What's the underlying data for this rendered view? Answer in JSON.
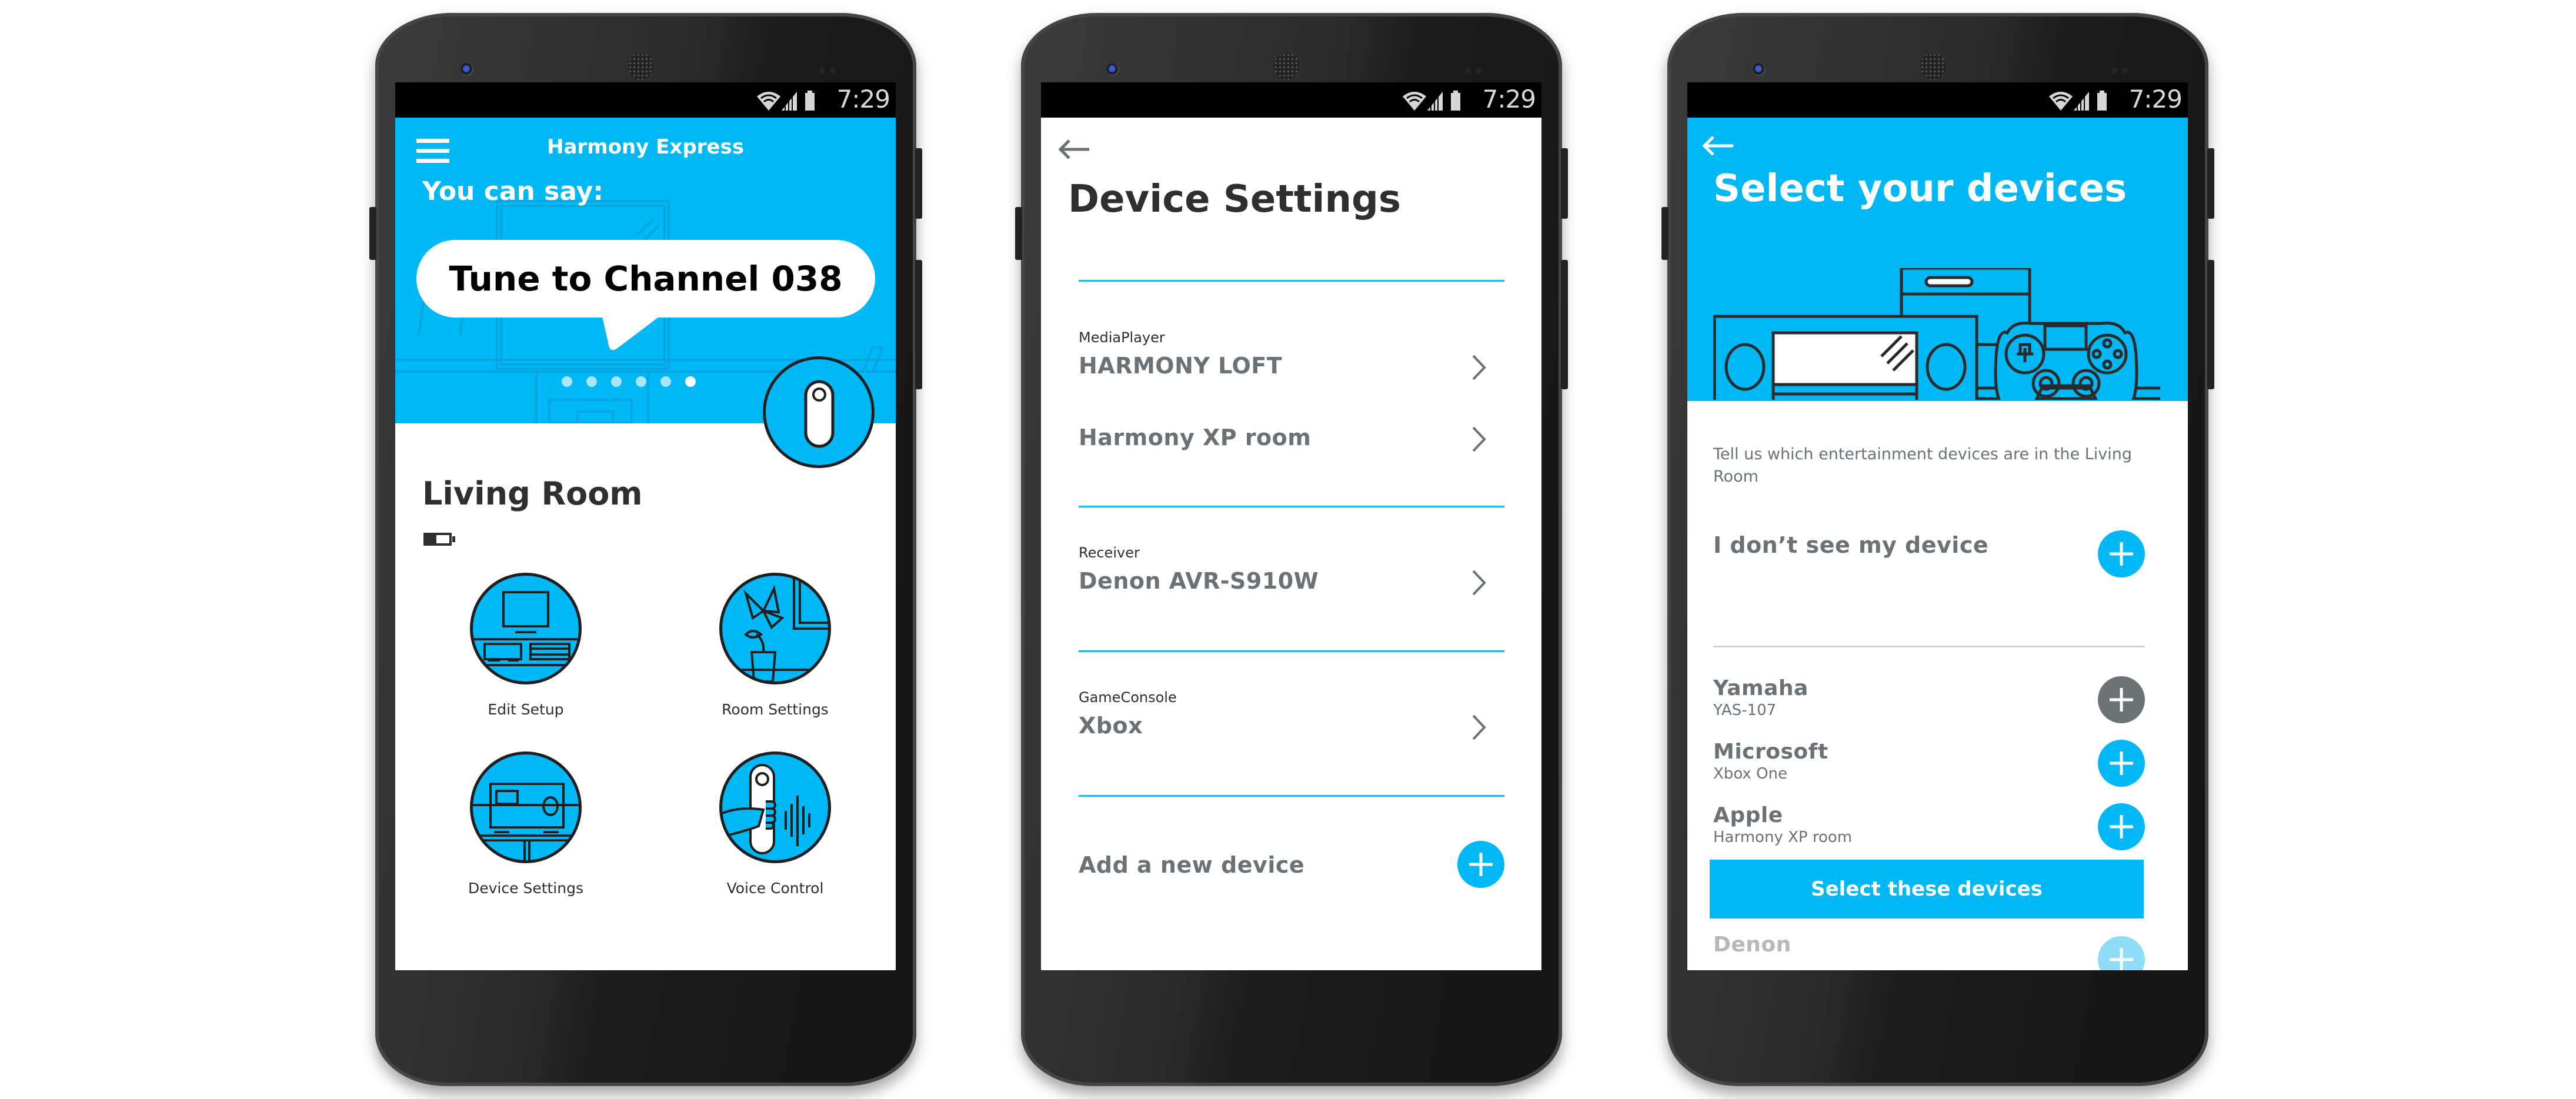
{
  "status_bar": {
    "time": "7:29"
  },
  "screen_home": {
    "app_title": "Harmony Express",
    "prompt_label": "You can say:",
    "voice_command_example": "Tune to Channel 038",
    "carousel": {
      "total": 6,
      "active_index": 5
    },
    "room_name": "Living Room",
    "tiles": [
      {
        "label": "Edit Setup",
        "icon": "tv-stand-icon"
      },
      {
        "label": "Room Settings",
        "icon": "plant-room-icon"
      },
      {
        "label": "Device Settings",
        "icon": "receiver-icon"
      },
      {
        "label": "Voice Control",
        "icon": "voice-remote-icon"
      }
    ]
  },
  "screen_device_settings": {
    "title": "Device Settings",
    "groups": [
      {
        "category": "MediaPlayer",
        "devices": [
          "HARMONY LOFT",
          "Harmony XP room"
        ]
      },
      {
        "category": "Receiver",
        "devices": [
          "Denon AVR-S910W"
        ]
      },
      {
        "category": "GameConsole",
        "devices": [
          "Xbox"
        ]
      }
    ],
    "add_label": "Add a new device"
  },
  "screen_select_devices": {
    "title": "Select your devices",
    "description": "Tell us which entertainment devices are in the Living Room",
    "not_found_label": "I don’t see my device",
    "devices": [
      {
        "brand": "Yamaha",
        "model": "YAS-107",
        "state": "selected"
      },
      {
        "brand": "Microsoft",
        "model": "Xbox One",
        "state": "default"
      },
      {
        "brand": "Apple",
        "model": "Harmony XP room",
        "state": "default"
      },
      {
        "brand": "Denon",
        "model": "",
        "state": "faded"
      }
    ],
    "primary_button": "Select these devices"
  },
  "colors": {
    "accent": "#00b8f5",
    "text_dark": "#2d2f30",
    "text_gray": "#6b7275",
    "selected_plus": "#6c7375"
  }
}
